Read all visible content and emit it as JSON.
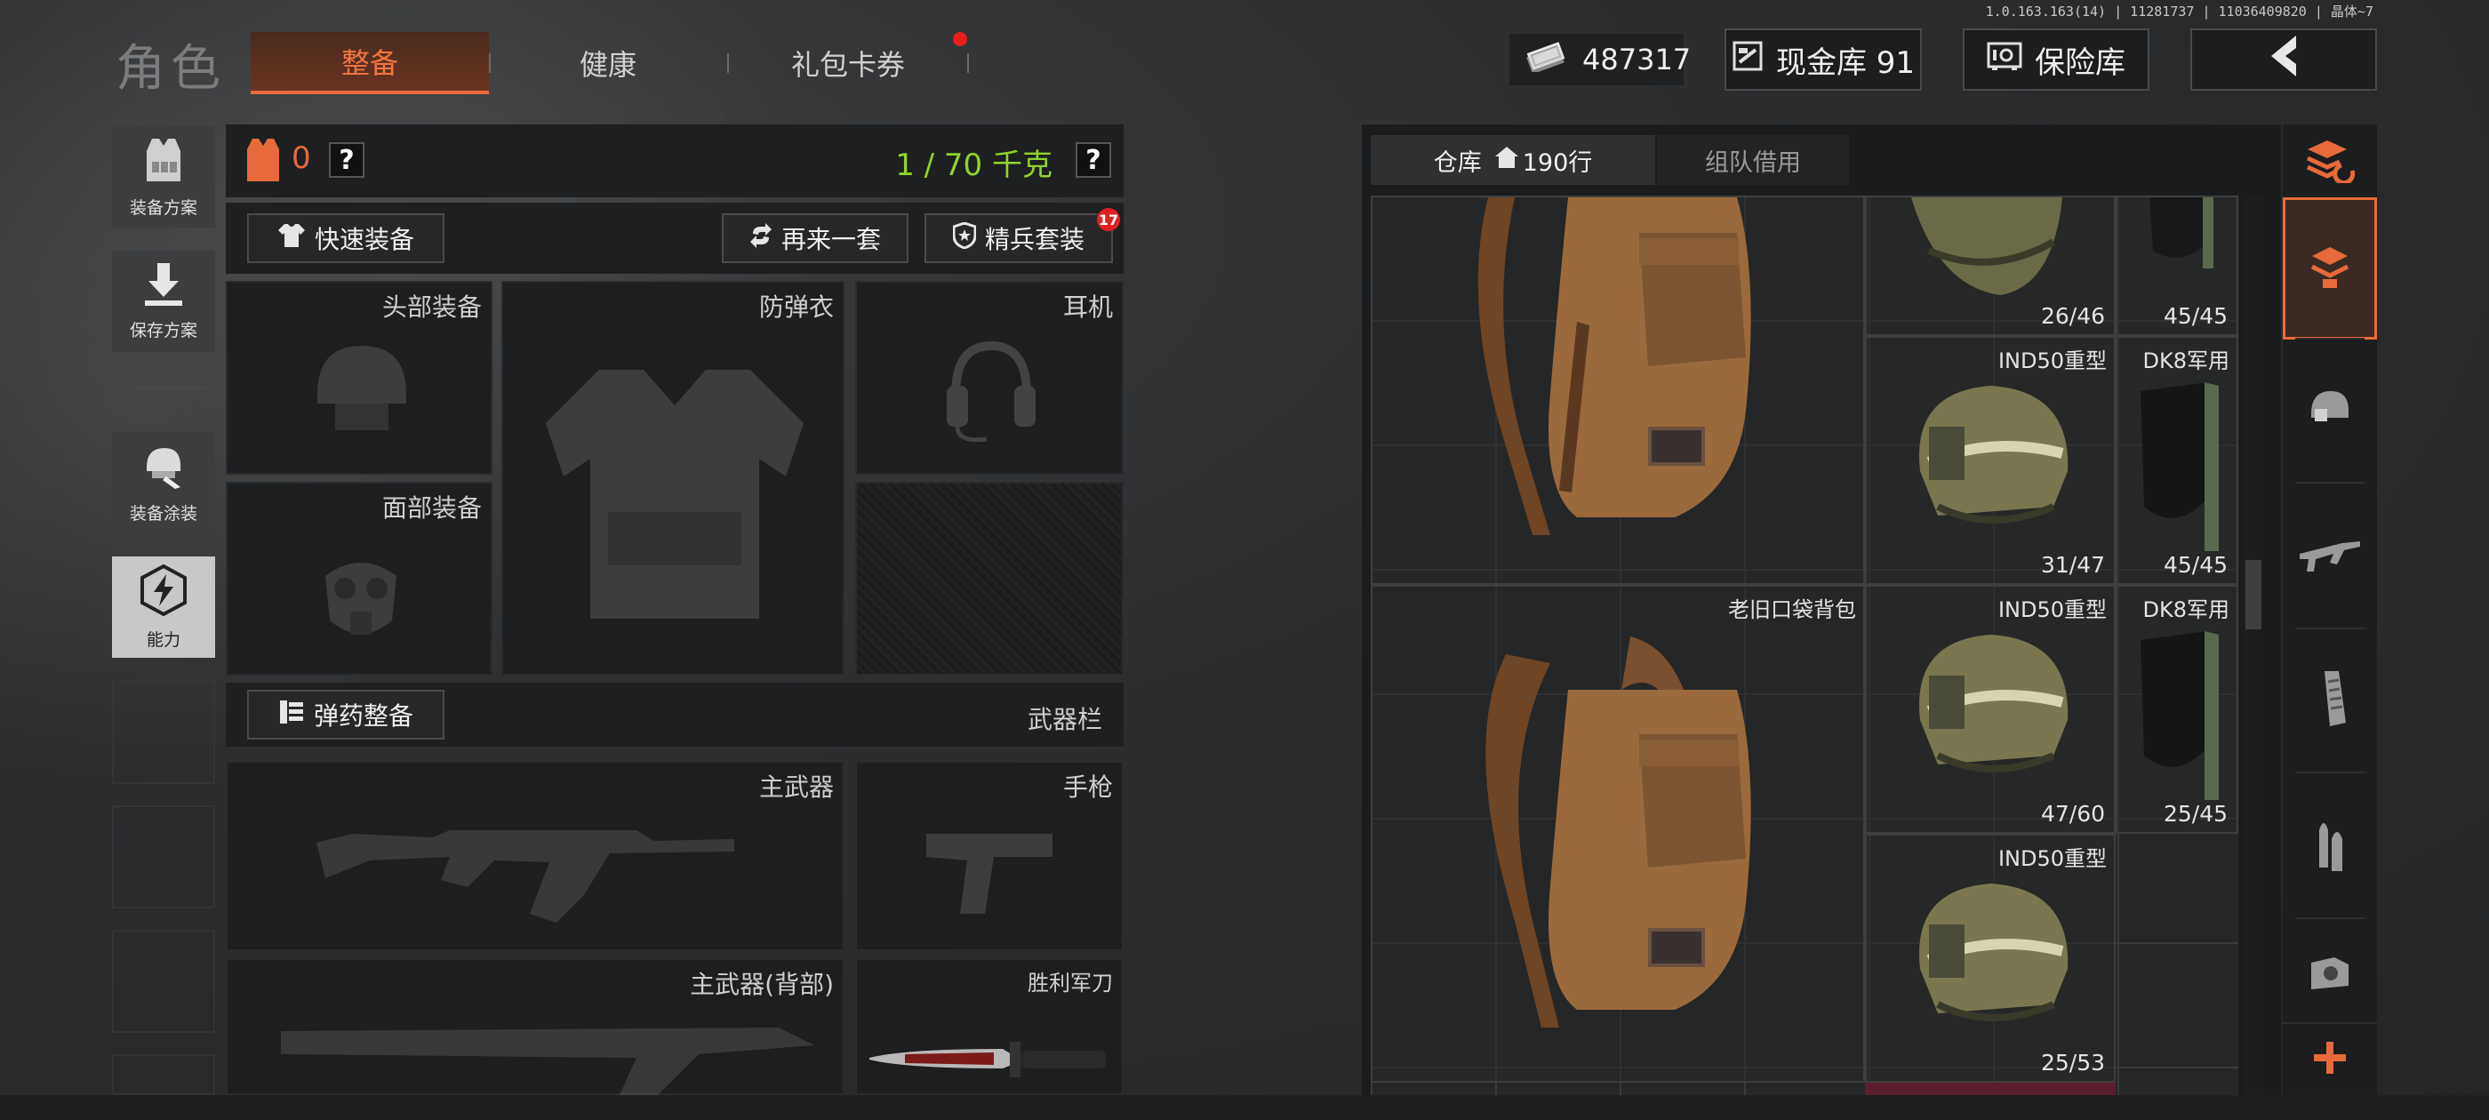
{
  "version_text": "1.0.163.163(14) | 11281737 | 11036409820 | 晶体~7",
  "header": {
    "section_title": "角色",
    "tabs": [
      {
        "label": "整备",
        "active": true
      },
      {
        "label": "健康",
        "active": false
      },
      {
        "label": "礼包卡券",
        "active": false,
        "notification": true
      }
    ],
    "money": "487317",
    "cash_vault": "现金库 91",
    "safe_vault": "保险库"
  },
  "sidebar": {
    "items": [
      {
        "label": "装备方案",
        "icon": "vest-icon"
      },
      {
        "label": "保存方案",
        "icon": "download-icon"
      },
      {
        "label": "装备涂装",
        "icon": "helmet-paint-icon"
      },
      {
        "label": "能力",
        "icon": "lightning-icon"
      }
    ]
  },
  "equip": {
    "armor_count": "0",
    "help": "?",
    "weight": "1 / 70 千克",
    "quick_equip": "快速装备",
    "another_set": "再来一套",
    "elite_set": "精兵套装",
    "elite_badge": "17",
    "slots": {
      "head": "头部装备",
      "armor": "防弹衣",
      "headset": "耳机",
      "face": "面部装备",
      "ammo_btn": "弹药整备",
      "weapon_bar": "武器栏",
      "primary": "主武器",
      "pistol": "手枪",
      "primary_back": "主武器(背部)",
      "knife": "胜利军刀"
    }
  },
  "storage": {
    "tab_warehouse": "仓库",
    "rows": "190行",
    "tab_team": "组队借用",
    "items": [
      {
        "name": "",
        "durability": "26/46"
      },
      {
        "name": "",
        "durability": "45/45"
      },
      {
        "name": "IND50重型",
        "durability": "31/47"
      },
      {
        "name": "DK8军用",
        "durability": "45/45"
      },
      {
        "name": "老旧口袋背包",
        "durability": ""
      },
      {
        "name": "IND50重型",
        "durability": "47/60"
      },
      {
        "name": "DK8军用",
        "durability": "25/45"
      },
      {
        "name": "IND50重型",
        "durability": "25/53"
      }
    ]
  },
  "colors": {
    "accent": "#e86a3a",
    "weight_green": "#8fd42b",
    "badge_red": "#e02020"
  }
}
